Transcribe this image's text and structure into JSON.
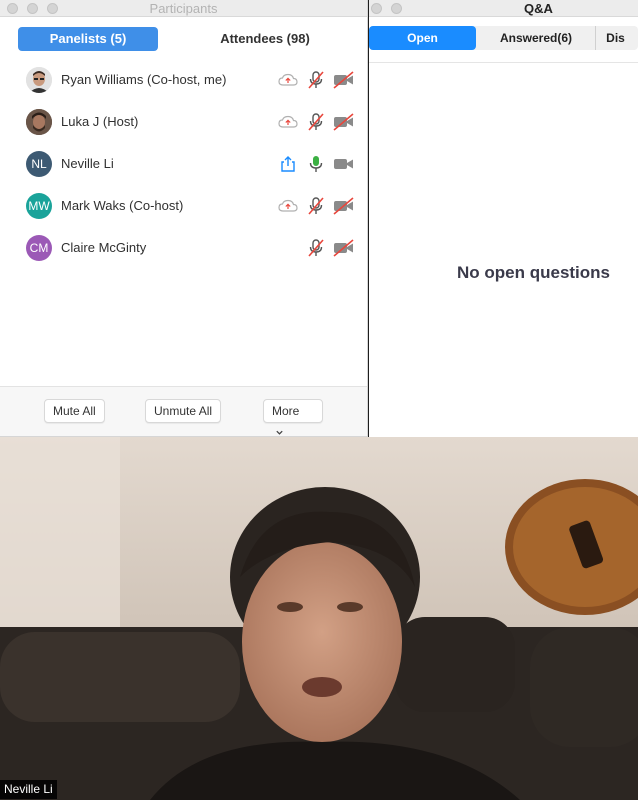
{
  "participants": {
    "window_title": "Participants",
    "tabs": {
      "panelists": "Panelists (5)",
      "attendees": "Attendees (98)"
    },
    "people": [
      {
        "name": "Ryan Williams (Co-host, me)",
        "avatar_type": "photo",
        "initials": "",
        "avatar_color": "#dcdcdc",
        "share": "cloud-icon",
        "mic": "muted",
        "video": "off"
      },
      {
        "name": "Luka J (Host)",
        "avatar_type": "photo",
        "initials": "",
        "avatar_color": "#5a4a3e",
        "share": "cloud-icon",
        "mic": "muted",
        "video": "off"
      },
      {
        "name": "Neville Li",
        "avatar_type": "initials",
        "initials": "NL",
        "avatar_color": "#3d5a73",
        "share": "share-screen-icon",
        "mic": "active",
        "video": "on"
      },
      {
        "name": "Mark Waks (Co-host)",
        "avatar_type": "initials",
        "initials": "MW",
        "avatar_color": "#1aa39a",
        "share": "cloud-icon",
        "mic": "muted",
        "video": "off"
      },
      {
        "name": "Claire McGinty",
        "avatar_type": "initials",
        "initials": "CM",
        "avatar_color": "#9b59b6",
        "share": "",
        "mic": "muted",
        "video": "off"
      }
    ],
    "footer": {
      "mute_all": "Mute All",
      "unmute_all": "Unmute All",
      "more": "More"
    }
  },
  "qa": {
    "window_title": "Q&A",
    "tabs": {
      "open": "Open",
      "answered": "Answered(6)",
      "dismissed": "Dis"
    },
    "empty_message": "No open questions"
  },
  "video": {
    "speaker_name": "Neville Li"
  },
  "colors": {
    "accent": "#3f8fe8",
    "muted_red": "#e8463c",
    "mic_green": "#3cb043"
  }
}
